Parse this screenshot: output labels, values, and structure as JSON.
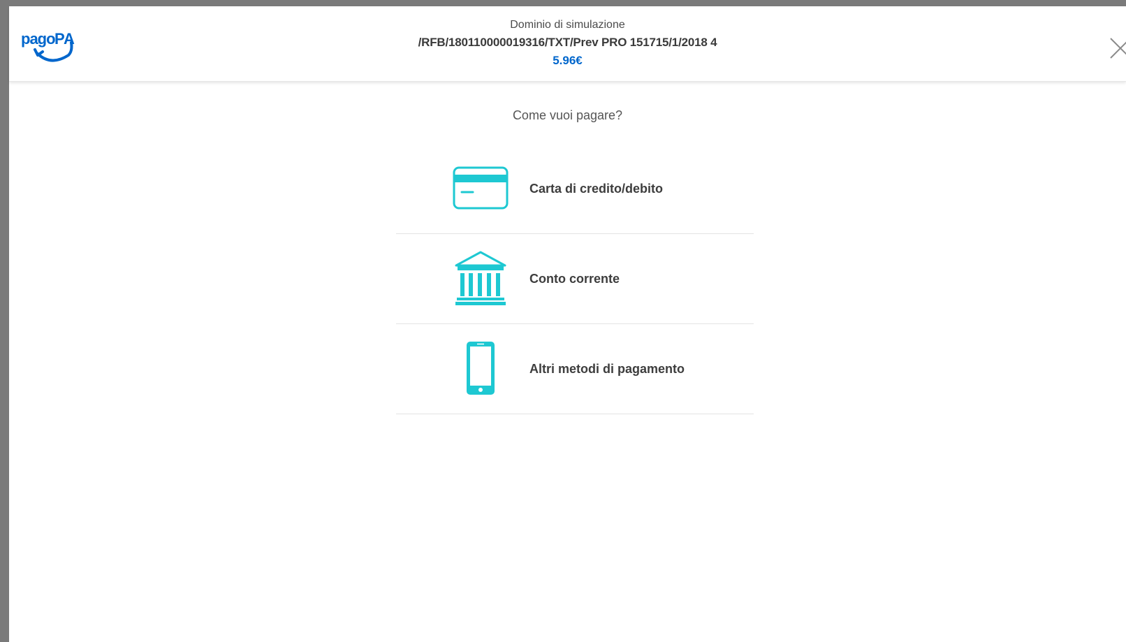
{
  "header": {
    "logo_text": "pagoPA",
    "domain": "Dominio di simulazione",
    "reference": "/RFB/180110000019316/TXT/Prev PRO 151715/1/2018 4",
    "amount": "5.96€"
  },
  "question": "Come vuoi pagare?",
  "methods": [
    {
      "label": "Carta di credito/debito",
      "icon": "credit-card-icon"
    },
    {
      "label": "Conto corrente",
      "icon": "bank-icon"
    },
    {
      "label": "Altri metodi di pagamento",
      "icon": "smartphone-icon"
    }
  ],
  "colors": {
    "accent": "#1ec8d2",
    "brand": "#0066cc",
    "frame": "#7a7a7a"
  }
}
